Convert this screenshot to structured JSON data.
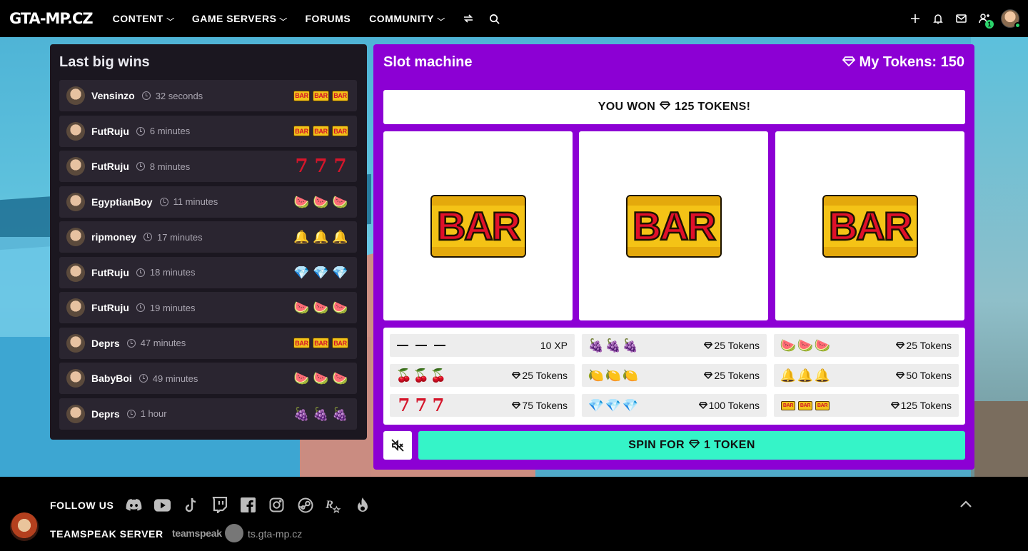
{
  "nav": {
    "logo": "GTA-MP.CZ",
    "items": [
      {
        "label": "CONTENT",
        "dropdown": true
      },
      {
        "label": "GAME SERVERS",
        "dropdown": true
      },
      {
        "label": "FORUMS",
        "dropdown": false
      },
      {
        "label": "COMMUNITY",
        "dropdown": true
      }
    ],
    "friend_requests_badge": "1"
  },
  "wins": {
    "title": "Last big wins",
    "rows": [
      {
        "user": "Vensinzo",
        "time": "32 seconds",
        "symbol": "bar"
      },
      {
        "user": "FutRuju",
        "time": "6 minutes",
        "symbol": "bar"
      },
      {
        "user": "FutRuju",
        "time": "8 minutes",
        "symbol": "seven"
      },
      {
        "user": "EgyptianBoy",
        "time": "11 minutes",
        "symbol": "watermelon"
      },
      {
        "user": "ripmoney",
        "time": "17 minutes",
        "symbol": "bell"
      },
      {
        "user": "FutRuju",
        "time": "18 minutes",
        "symbol": "diamond"
      },
      {
        "user": "FutRuju",
        "time": "19 minutes",
        "symbol": "watermelon"
      },
      {
        "user": "Deprs",
        "time": "47 minutes",
        "symbol": "bar"
      },
      {
        "user": "BabyBoi",
        "time": "49 minutes",
        "symbol": "watermelon"
      },
      {
        "user": "Deprs",
        "time": "1 hour",
        "symbol": "grapes"
      }
    ]
  },
  "slot": {
    "title": "Slot machine",
    "tokens_label": "My Tokens: 150",
    "won_prefix": "YOU WON",
    "won_suffix": "125 TOKENS!",
    "reels": [
      "BAR",
      "BAR",
      "BAR"
    ],
    "paytable": [
      {
        "symbol": "none",
        "value": "10 XP"
      },
      {
        "symbol": "grapes",
        "value": "25 Tokens"
      },
      {
        "symbol": "watermelon",
        "value": "25 Tokens"
      },
      {
        "symbol": "cherries",
        "value": "25 Tokens"
      },
      {
        "symbol": "lemon",
        "value": "25 Tokens"
      },
      {
        "symbol": "bell",
        "value": "50 Tokens"
      },
      {
        "symbol": "seven",
        "value": "75 Tokens"
      },
      {
        "symbol": "diamond",
        "value": "100 Tokens"
      },
      {
        "symbol": "bar",
        "value": "125 Tokens"
      }
    ],
    "spin_prefix": "SPIN FOR",
    "spin_suffix": "1 TOKEN"
  },
  "footer": {
    "follow_label": "FOLLOW US",
    "socials": [
      "discord-icon",
      "youtube-icon",
      "tiktok-icon",
      "twitch-icon",
      "facebook-icon",
      "instagram-icon",
      "steam-icon",
      "rockstar-icon",
      "fire-icon"
    ],
    "teamspeak_label": "TEAMSPEAK SERVER",
    "teamspeak_logo": "teamspeak",
    "teamspeak_address": "ts.gta-mp.cz"
  },
  "colors": {
    "slot_bg": "#8c00d4",
    "spin_button": "#35f4c8",
    "panel_bg": "#1b1720",
    "row_bg": "#2a2530"
  }
}
